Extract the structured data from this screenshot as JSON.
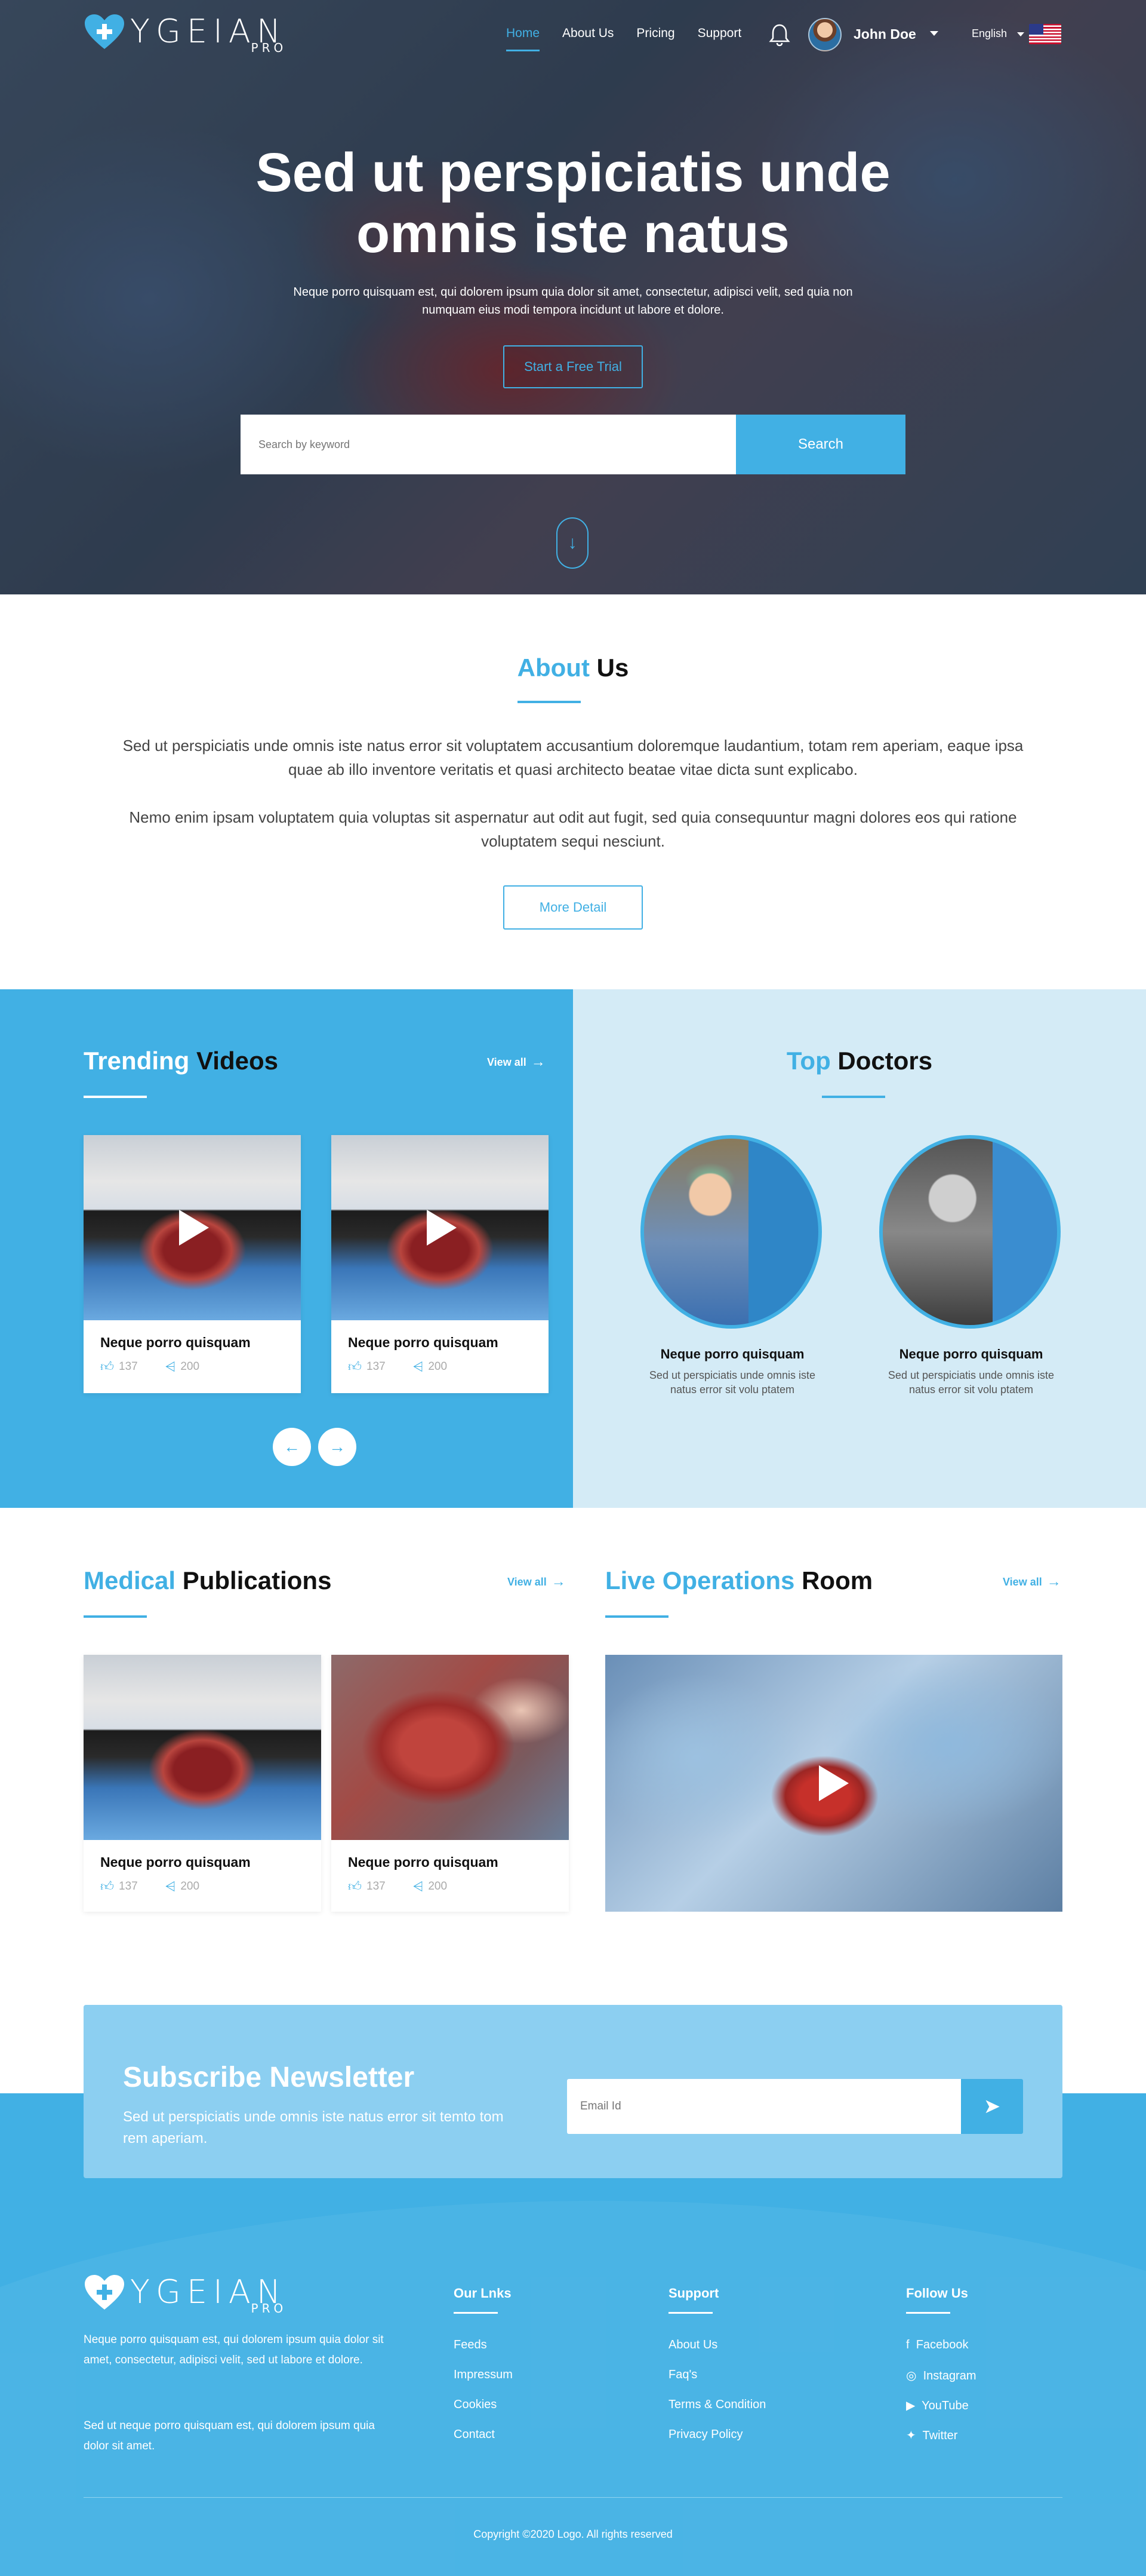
{
  "brand": {
    "name": "YGEIAN",
    "tag": "PRO"
  },
  "nav": {
    "items": [
      "Home",
      "About Us",
      "Pricing",
      "Support"
    ]
  },
  "user": {
    "name": "John Doe",
    "language": "English"
  },
  "hero": {
    "title_line1": "Sed ut perspiciatis unde",
    "title_line2": "omnis iste natus",
    "subtitle": "Neque porro quisquam est, qui dolorem ipsum quia dolor sit amet, consectetur, adipisci velit, sed quia non numquam eius modi tempora incidunt ut labore et dolore.",
    "cta": "Start a Free Trial",
    "search_placeholder": "Search by keyword",
    "search_button": "Search"
  },
  "about": {
    "title_blue": "About",
    "title_dark": "Us",
    "p1": "Sed ut perspiciatis unde omnis iste natus error sit voluptatem accusantium doloremque laudantium, totam rem aperiam, eaque ipsa quae ab illo inventore veritatis et quasi architecto beatae vitae dicta sunt explicabo.",
    "p2": "Nemo enim ipsam voluptatem quia voluptas sit aspernatur aut odit aut fugit, sed quia consequuntur magni dolores eos qui ratione voluptatem sequi nesciunt.",
    "button": "More Detail"
  },
  "trending": {
    "title_blue": "Trending",
    "title_dark": "Videos",
    "view_all": "View all",
    "cards": [
      {
        "title": "Neque porro quisquam",
        "likes": "137",
        "shares": "200"
      },
      {
        "title": "Neque porro quisquam",
        "likes": "137",
        "shares": "200"
      }
    ]
  },
  "doctors": {
    "title_blue": "Top",
    "title_dark": "Doctors",
    "items": [
      {
        "name": "Neque porro quisquam",
        "desc": "Sed ut perspiciatis unde omnis iste natus error sit volu ptatem"
      },
      {
        "name": "Neque porro quisquam",
        "desc": "Sed ut perspiciatis unde omnis iste natus error sit volu ptatem"
      }
    ]
  },
  "publications": {
    "title_blue": "Medical",
    "title_dark": "Publications",
    "view_all": "View all",
    "cards": [
      {
        "title": "Neque porro quisquam",
        "likes": "137",
        "shares": "200"
      },
      {
        "title": "Neque porro quisquam",
        "likes": "137",
        "shares": "200"
      }
    ]
  },
  "live": {
    "title_blue": "Live Operations",
    "title_dark": "Room",
    "view_all": "View all"
  },
  "newsletter": {
    "title": "Subscribe Newsletter",
    "desc": "Sed ut perspiciatis unde omnis iste natus error sit temto tom rem aperiam.",
    "placeholder": "Email Id"
  },
  "footer": {
    "about1": "Neque porro quisquam est, qui dolorem ipsum quia dolor sit amet, consectetur, adipisci velit, sed ut labore et dolore.",
    "about2": "Sed ut  neque porro quisquam est, qui dolorem ipsum quia dolor sit amet.",
    "links_title": "Our Lnks",
    "links": [
      "Feeds",
      "Impressum",
      "Cookies",
      "Contact"
    ],
    "support_title": "Support",
    "support": [
      "About Us",
      "Faq's",
      "Terms & Condition",
      "Privacy Policy"
    ],
    "follow_title": "Follow Us",
    "follow": [
      "Facebook",
      "Instagram",
      "YouTube",
      "Twitter"
    ],
    "copyright": "Copyright ©2020 Logo. All rights reserved"
  },
  "colors": {
    "accent": "#41b0e4",
    "accent_light": "#d4ebf6",
    "newsletter_box": "#8ccff1"
  }
}
